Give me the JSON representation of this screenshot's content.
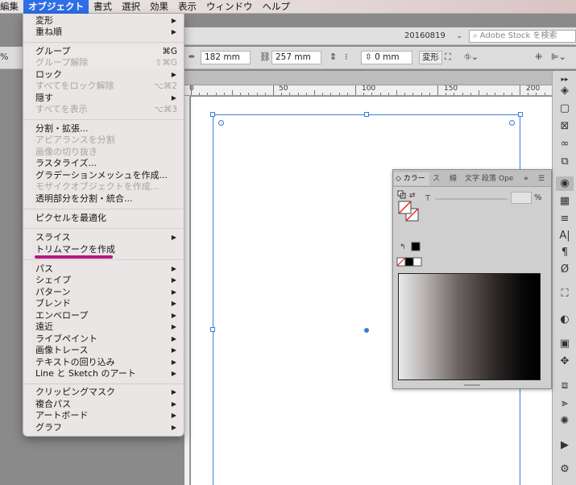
{
  "menubar": {
    "items": [
      "編集",
      "オブジェクト",
      "書式",
      "選択",
      "効果",
      "表示",
      "ウィンドウ",
      "ヘルプ"
    ],
    "active_index": 1
  },
  "appbar": {
    "workspace": "20160819",
    "stock_search_placeholder": "Adobe Stock を検索"
  },
  "controlbar": {
    "left_partial": "%",
    "width": "182 mm",
    "height": "257 mm",
    "offset": "0 mm",
    "transform_label": "変形"
  },
  "ruler": {
    "labels": [
      "0",
      "50",
      "100",
      "150",
      "200"
    ]
  },
  "menu": {
    "items": [
      {
        "label": "変形",
        "shortcut": "",
        "submenu": true,
        "disabled": false
      },
      {
        "label": "重ね順",
        "shortcut": "",
        "submenu": true,
        "disabled": false
      },
      {
        "label": "グループ",
        "shortcut": "⌘G",
        "submenu": false,
        "disabled": false
      },
      {
        "label": "グループ解除",
        "shortcut": "⇧⌘G",
        "submenu": false,
        "disabled": true
      },
      {
        "label": "ロック",
        "shortcut": "",
        "submenu": true,
        "disabled": false
      },
      {
        "label": "すべてをロック解除",
        "shortcut": "⌥⌘2",
        "submenu": false,
        "disabled": true
      },
      {
        "label": "隠す",
        "shortcut": "",
        "submenu": true,
        "disabled": false
      },
      {
        "label": "すべてを表示",
        "shortcut": "⌥⌘3",
        "submenu": false,
        "disabled": true
      },
      {
        "label": "分割・拡張...",
        "shortcut": "",
        "submenu": false,
        "disabled": false
      },
      {
        "label": "アピアランスを分割",
        "shortcut": "",
        "submenu": false,
        "disabled": true
      },
      {
        "label": "画像の切り抜き",
        "shortcut": "",
        "submenu": false,
        "disabled": true
      },
      {
        "label": "ラスタライズ...",
        "shortcut": "",
        "submenu": false,
        "disabled": false
      },
      {
        "label": "グラデーションメッシュを作成...",
        "shortcut": "",
        "submenu": false,
        "disabled": false
      },
      {
        "label": "モザイクオブジェクトを作成...",
        "shortcut": "",
        "submenu": false,
        "disabled": true
      },
      {
        "label": "透明部分を分割・統合...",
        "shortcut": "",
        "submenu": false,
        "disabled": false
      },
      {
        "label": "ピクセルを最適化",
        "shortcut": "",
        "submenu": false,
        "disabled": false
      },
      {
        "label": "スライス",
        "shortcut": "",
        "submenu": true,
        "disabled": false
      },
      {
        "label": "トリムマークを作成",
        "shortcut": "",
        "submenu": false,
        "disabled": false
      },
      {
        "label": "パス",
        "shortcut": "",
        "submenu": true,
        "disabled": false
      },
      {
        "label": "シェイプ",
        "shortcut": "",
        "submenu": true,
        "disabled": false
      },
      {
        "label": "パターン",
        "shortcut": "",
        "submenu": true,
        "disabled": false
      },
      {
        "label": "ブレンド",
        "shortcut": "",
        "submenu": true,
        "disabled": false
      },
      {
        "label": "エンベロープ",
        "shortcut": "",
        "submenu": true,
        "disabled": false
      },
      {
        "label": "遠近",
        "shortcut": "",
        "submenu": true,
        "disabled": false
      },
      {
        "label": "ライブペイント",
        "shortcut": "",
        "submenu": true,
        "disabled": false
      },
      {
        "label": "画像トレース",
        "shortcut": "",
        "submenu": true,
        "disabled": false
      },
      {
        "label": "テキストの回り込み",
        "shortcut": "",
        "submenu": true,
        "disabled": false
      },
      {
        "label": "Line と Sketch のアート",
        "shortcut": "",
        "submenu": true,
        "disabled": false
      },
      {
        "label": "クリッピングマスク",
        "shortcut": "",
        "submenu": true,
        "disabled": false
      },
      {
        "label": "複合パス",
        "shortcut": "",
        "submenu": true,
        "disabled": false
      },
      {
        "label": "アートボード",
        "shortcut": "",
        "submenu": true,
        "disabled": false
      },
      {
        "label": "グラフ",
        "shortcut": "",
        "submenu": true,
        "disabled": false
      }
    ],
    "highlighted_item": "トリムマークを作成",
    "highlight_color": "#b7177e"
  },
  "color_panel": {
    "tabs": [
      "カラー",
      "ス",
      "線",
      "文字",
      "段落",
      "Ope"
    ],
    "tint_label": "T",
    "percent": "%"
  },
  "colors": {
    "menu_active": "#2f6ee8",
    "selection": "#3b7be0"
  }
}
